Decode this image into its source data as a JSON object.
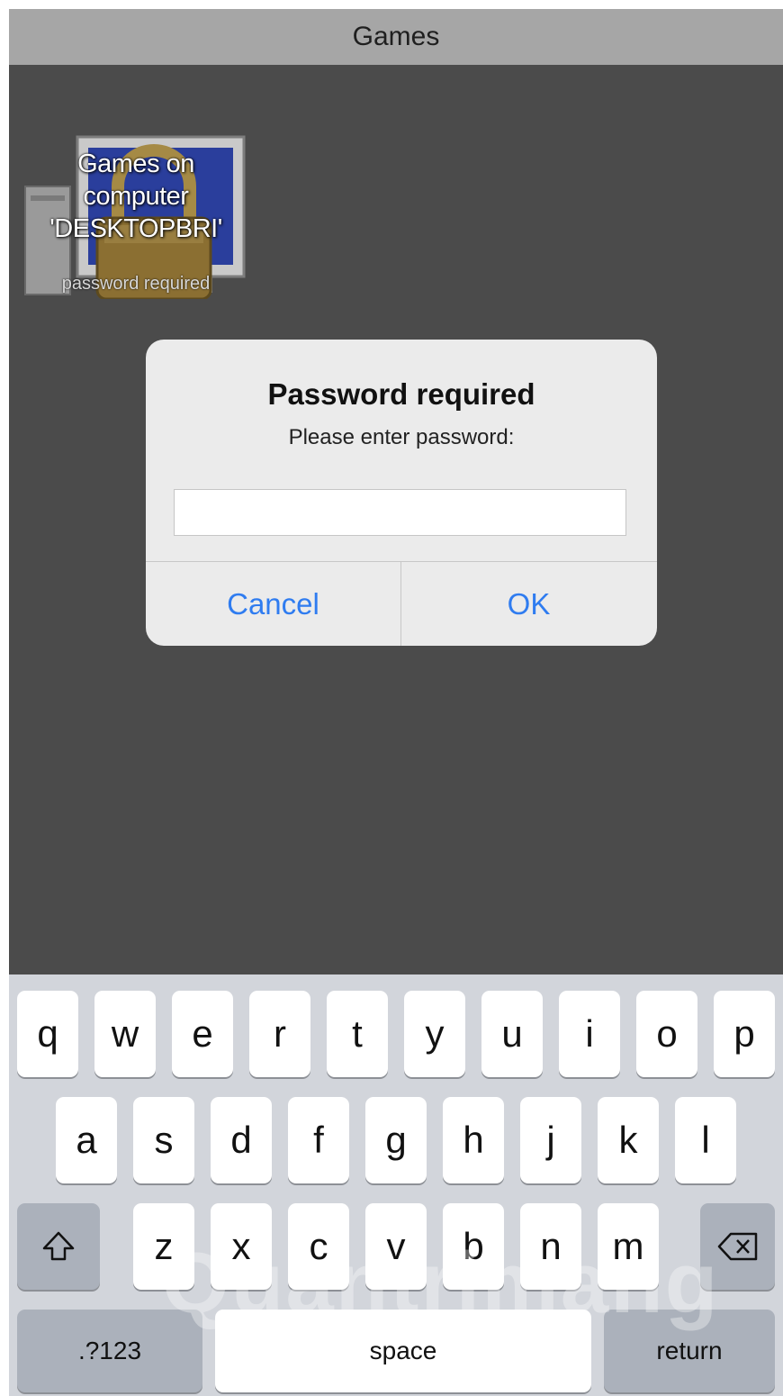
{
  "nav": {
    "title": "Games"
  },
  "share": {
    "name": "Games on\ncomputer\n'DESKTOPBRI'",
    "status": "password required"
  },
  "dialog": {
    "title": "Password required",
    "message": "Please enter password:",
    "password_value": "",
    "cancel_label": "Cancel",
    "ok_label": "OK"
  },
  "keyboard": {
    "row1": [
      "q",
      "w",
      "e",
      "r",
      "t",
      "y",
      "u",
      "i",
      "o",
      "p"
    ],
    "row2": [
      "a",
      "s",
      "d",
      "f",
      "g",
      "h",
      "j",
      "k",
      "l"
    ],
    "row3": [
      "z",
      "x",
      "c",
      "v",
      "b",
      "n",
      "m"
    ],
    "shift_icon": "shift-icon",
    "backspace_icon": "backspace-icon",
    "numbers_label": ".?123",
    "space_label": "space",
    "return_label": "return"
  },
  "watermark": "Quantrimang",
  "colors": {
    "accent": "#2f7cf0",
    "nav_bg": "#a6a6a6",
    "content_bg": "#4b4b4b",
    "keyboard_bg": "#d2d5db"
  }
}
